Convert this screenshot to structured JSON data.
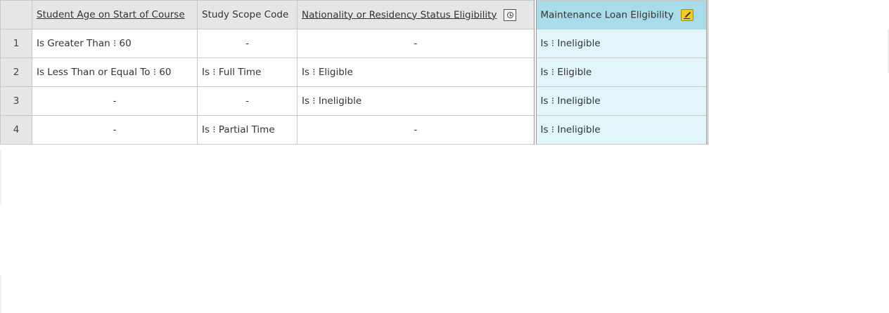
{
  "table": {
    "columns": [
      {
        "label": "Student Age on Start of Course"
      },
      {
        "label": "Study Scope Code"
      },
      {
        "label": "Nationality or Residency Status Eligibility",
        "icon": "history-icon"
      },
      {
        "label": "Maintenance Loan Eligibility",
        "icon": "edit-icon"
      }
    ],
    "rows": [
      {
        "index": "1",
        "cells": [
          "Is Greater Than ⁝ 60",
          "-",
          "-",
          "Is ⁝ Ineligible"
        ]
      },
      {
        "index": "2",
        "cells": [
          "Is Less Than or Equal To ⁝ 60",
          "Is ⁝ Full Time",
          "Is ⁝ Eligible",
          "Is ⁝ Eligible"
        ]
      },
      {
        "index": "3",
        "cells": [
          "-",
          "-",
          "Is ⁝ Ineligible",
          "Is ⁝ Ineligible"
        ]
      },
      {
        "index": "4",
        "cells": [
          "-",
          "Is ⁝ Partial Time",
          "-",
          "Is ⁝ Ineligible"
        ]
      }
    ]
  },
  "colors": {
    "header_bg": "#e6e6e6",
    "output_header_bg": "#a9dcea",
    "output_cell_bg": "#e2f5fb",
    "edit_icon": "#f3cc1d"
  }
}
